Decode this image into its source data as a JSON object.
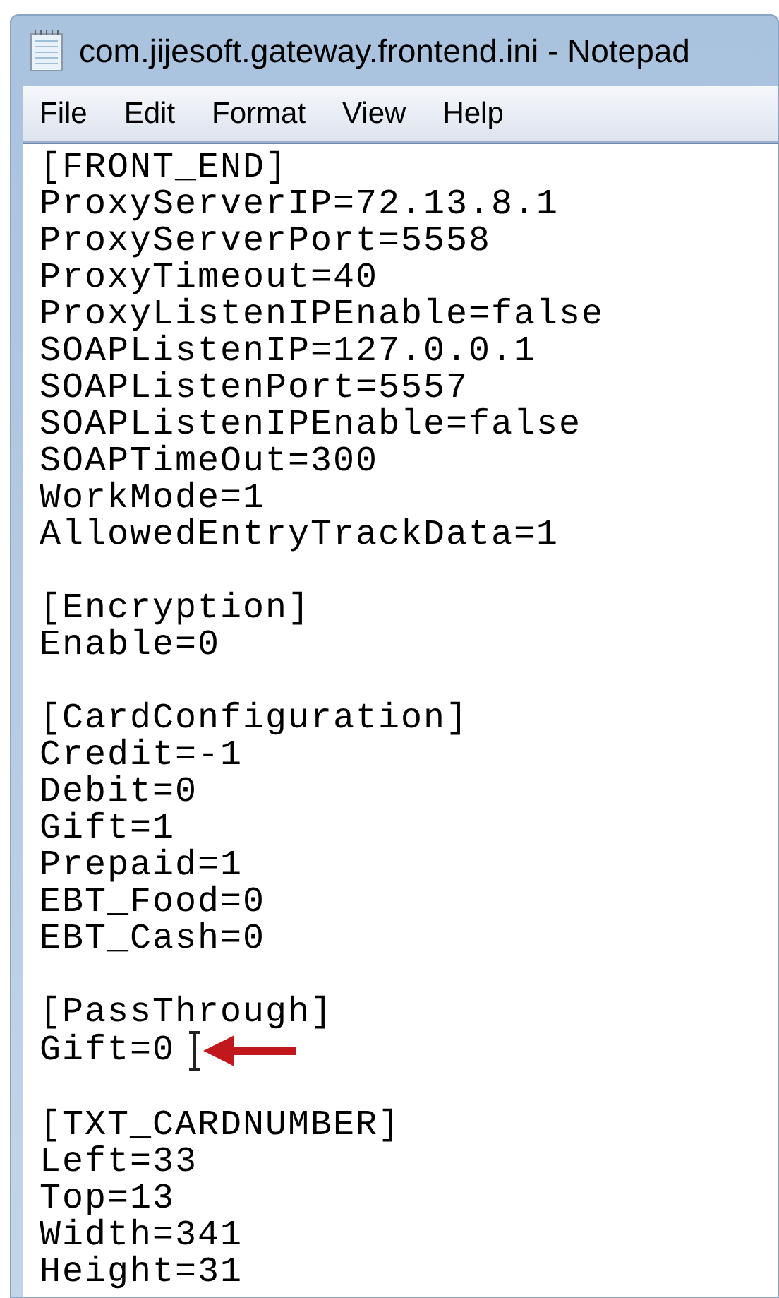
{
  "window": {
    "title": "com.jijesoft.gateway.frontend.ini - Notepad"
  },
  "menu": [
    "File",
    "Edit",
    "Format",
    "View",
    "Help"
  ],
  "sections": [
    {
      "header": "[FRONT_END]",
      "lines": [
        "ProxyServerIP=72.13.8.1",
        "ProxyServerPort=5558",
        "ProxyTimeout=40",
        "ProxyListenIPEnable=false",
        "SOAPListenIP=127.0.0.1",
        "SOAPListenPort=5557",
        "SOAPListenIPEnable=false",
        "SOAPTimeOut=300",
        "WorkMode=1",
        "AllowedEntryTrackData=1"
      ]
    },
    {
      "header": "[Encryption]",
      "lines": [
        "Enable=0"
      ]
    },
    {
      "header": "[CardConfiguration]",
      "lines": [
        "Credit=-1",
        "Debit=0",
        "Gift=1",
        "Prepaid=1",
        "EBT_Food=0",
        "EBT_Cash=0"
      ]
    },
    {
      "header": "[PassThrough]",
      "lines": [
        "Gift=0"
      ],
      "pointed_lines": [
        true
      ]
    },
    {
      "header": "[TXT_CARDNUMBER]",
      "lines": [
        "Left=33",
        "Top=13",
        "Width=341",
        "Height=31"
      ]
    }
  ]
}
